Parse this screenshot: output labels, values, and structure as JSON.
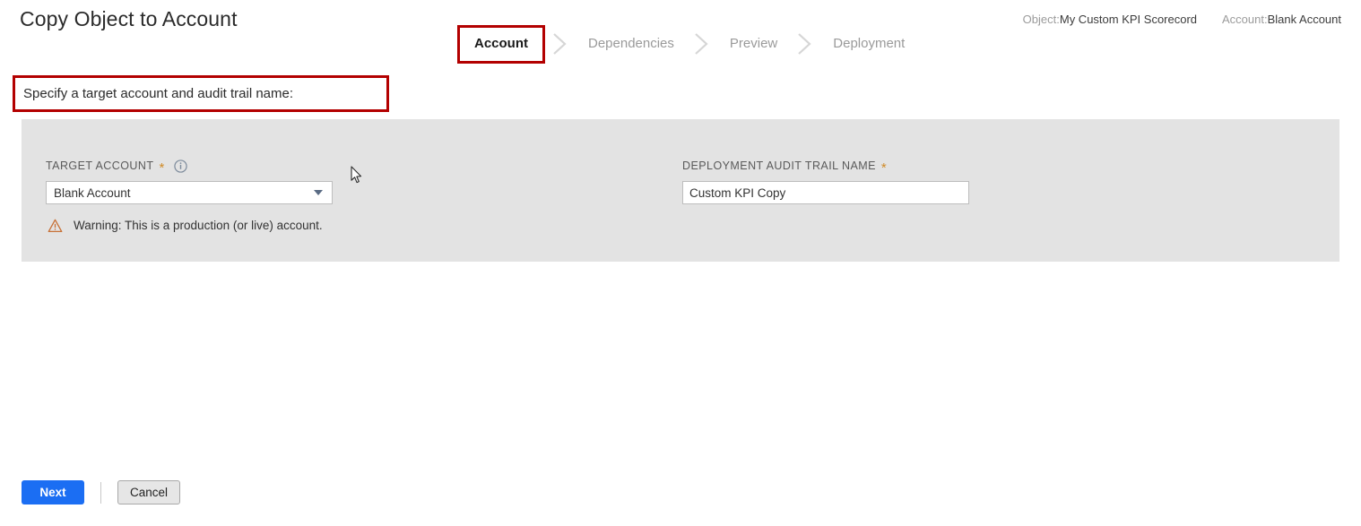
{
  "page": {
    "title": "Copy Object to Account",
    "instruction": "Specify a target account and audit trail name:"
  },
  "wizard": {
    "steps": [
      {
        "label": "Account",
        "state": "active"
      },
      {
        "label": "Dependencies",
        "state": "upcoming"
      },
      {
        "label": "Preview",
        "state": "upcoming"
      },
      {
        "label": "Deployment",
        "state": "upcoming"
      }
    ]
  },
  "meta": {
    "object_label": "Object:",
    "object_value": "My Custom KPI Scorecord",
    "account_label": "Account:",
    "account_value": "Blank Account"
  },
  "form": {
    "target_account": {
      "label": "TARGET ACCOUNT",
      "required_marker": "*",
      "info_icon": "info-circle-icon",
      "value": "Blank Account",
      "caret_icon": "chevron-down-icon"
    },
    "audit_trail": {
      "label": "DEPLOYMENT AUDIT TRAIL NAME",
      "required_marker": "*",
      "value": "Custom KPI Copy",
      "placeholder": ""
    },
    "warning": {
      "icon": "warning-triangle-icon",
      "text": "Warning: This is a production (or live) account."
    }
  },
  "footer": {
    "next_label": "Next",
    "cancel_label": "Cancel"
  },
  "colors": {
    "annotation_red": "#b30000",
    "primary_blue": "#1b6ef3",
    "panel_gray": "#e3e3e3",
    "warning_orange": "#c87137",
    "required_star": "#d08b28"
  }
}
